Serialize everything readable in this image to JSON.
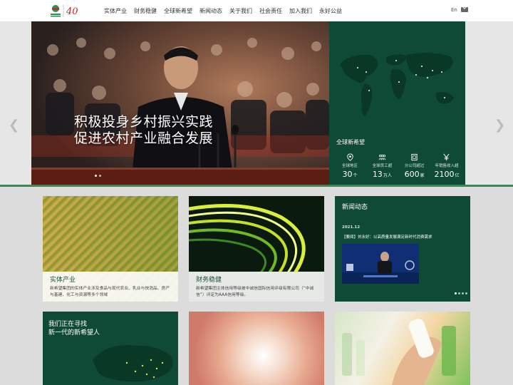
{
  "header": {
    "logo_badge": "40",
    "nav": [
      "实体产业",
      "财务稳健",
      "全球新希望",
      "新闻动态",
      "关于我们",
      "社会责任",
      "加入我们",
      "永好公益"
    ],
    "lang": "En"
  },
  "hero": {
    "title_line1": "积极投身乡村振兴实践",
    "title_line2": "促进农村产业融合发展",
    "panel": {
      "title": "全球新希望",
      "stats": [
        {
          "icon": "location-pin-icon",
          "label": "全球地区",
          "value": "30",
          "unit": "个"
        },
        {
          "icon": "people-icon",
          "label": "全球员工超",
          "value": "13",
          "unit": "万人"
        },
        {
          "icon": "building-icon",
          "label": "分公司超过",
          "value": "600",
          "unit": "家"
        },
        {
          "icon": "yen-icon",
          "label": "年销售收入超",
          "value": "2100",
          "unit": "亿"
        }
      ]
    }
  },
  "cards": {
    "fields": {
      "title": "实体产业",
      "text": "新希望集团的实体产业涉及食品与现代农业、乳业与快消品、房产与基建、化工与资源等多个领域"
    },
    "finance": {
      "title": "财务稳健",
      "text": "新希望集团主体信用等级被中诚信国际信用评级有限公司（“中诚信”）评定为AAA信用等级。"
    },
    "news": {
      "title": "新闻动态",
      "date": "2021.12",
      "headline": "【要闻】刘永好：以高质量发展满足新时代消费需求"
    },
    "recruit": {
      "title_line1": "我们正在寻找",
      "title_line2": "新一代的新希望人"
    }
  },
  "colors": {
    "brand_green": "#0f4a36",
    "accent_green": "#2f8f4e"
  }
}
